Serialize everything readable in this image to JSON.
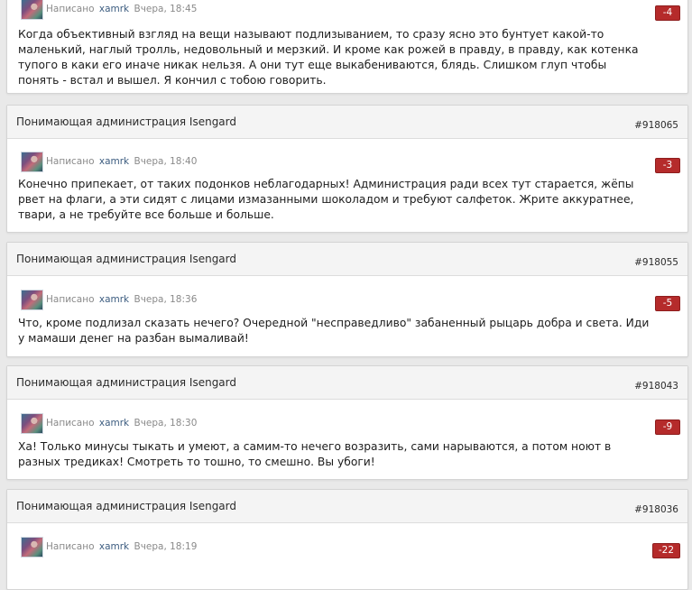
{
  "posts": [
    {
      "title": "",
      "id": "",
      "prefix": "Написано",
      "author": "xamrk",
      "time": "Вчера, 18:45",
      "vote": "-4",
      "text": "Когда объективный взгляд на вещи называют подлизыванием, то сразу ясно это бунтует какой-то маленький, наглый тролль, недовольный и мерзкий. И кроме как рожей в правду, в правду, как котенка тупого в каки его иначе никак нельзя. А они тут еще выкабениваются, блядь.  Слишком глуп чтобы понять - встал и вышел. Я кончил с тобою говорить."
    },
    {
      "title": "Понимающая администрация Isengard",
      "id": "#918065",
      "prefix": "Написано",
      "author": "xamrk",
      "time": "Вчера, 18:40",
      "vote": "-3",
      "text": "Конечно припекает, от таких подонков неблагодарных! Администрация ради всех тут старается, жёпы рвет на флаги, а эти сидят с лицами измазанными шоколадом и требуют салфеток. Жрите аккуратнее, твари, а не требуйте все больше и больше."
    },
    {
      "title": "Понимающая администрация Isengard",
      "id": "#918055",
      "prefix": "Написано",
      "author": "xamrk",
      "time": "Вчера, 18:36",
      "vote": "-5",
      "text": "Что, кроме подлизал сказать нечего? Очередной \"несправедливо\" забаненный рыцарь добра и света.  Иди у мамаши денег на разбан вымаливай!"
    },
    {
      "title": "Понимающая администрация Isengard",
      "id": "#918043",
      "prefix": "Написано",
      "author": "xamrk",
      "time": "Вчера, 18:30",
      "vote": "-9",
      "text": "Ха! Только минусы тыкать и умеют, а самим-то нечего возразить, сами нарываются, а потом ноют в разных тредиках! Смотреть то тошно, то смешно. Вы убоги!"
    },
    {
      "title": "Понимающая администрация Isengard",
      "id": "#918036",
      "prefix": "Написано",
      "author": "xamrk",
      "time": "Вчера, 18:19",
      "vote": "-22",
      "text": ""
    }
  ]
}
